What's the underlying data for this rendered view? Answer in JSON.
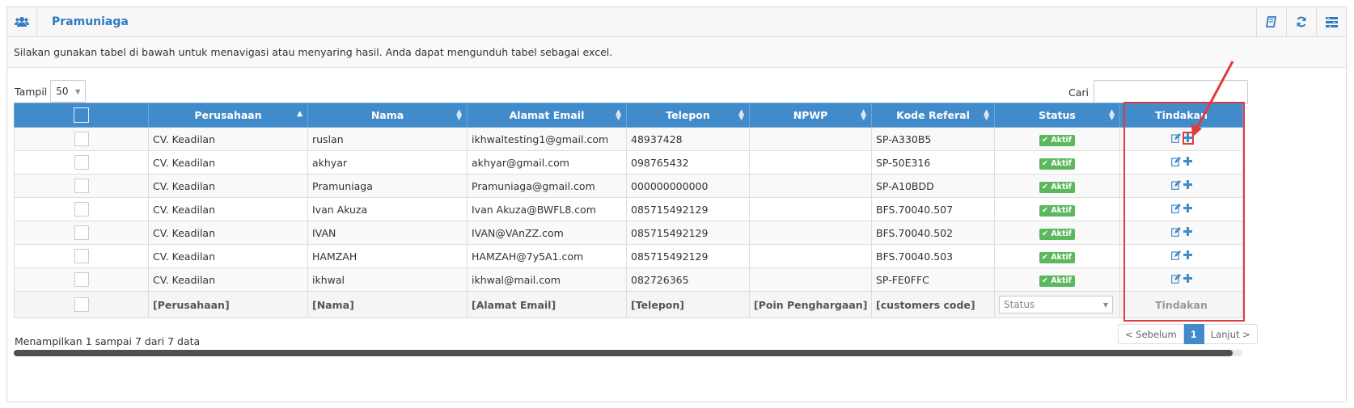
{
  "header": {
    "title": "Pramuniaga",
    "icons": [
      "users-icon",
      "book-icon",
      "refresh-icon",
      "list-settings-icon"
    ]
  },
  "description": "Silakan gunakan tabel di bawah untuk menavigasi atau menyaring hasil. Anda dapat mengunduh tabel sebagai excel.",
  "length_control": {
    "label": "Tampil",
    "value": "50"
  },
  "search": {
    "label": "Cari",
    "value": ""
  },
  "table": {
    "columns": [
      "",
      "Perusahaan",
      "Nama",
      "Alamat Email",
      "Telepon",
      "NPWP",
      "Kode Referal",
      "Status",
      "Tindakan"
    ],
    "rows": [
      {
        "perusahaan": "CV. Keadilan",
        "nama": "ruslan",
        "email": "ikhwaltesting1@gmail.com",
        "telepon": "48937428",
        "npwp": "",
        "kode": "SP-A330B5",
        "status": "Aktif"
      },
      {
        "perusahaan": "CV. Keadilan",
        "nama": "akhyar",
        "email": "akhyar@gmail.com",
        "telepon": "098765432",
        "npwp": "",
        "kode": "SP-50E316",
        "status": "Aktif"
      },
      {
        "perusahaan": "CV. Keadilan",
        "nama": "Pramuniaga",
        "email": "Pramuniaga@gmail.com",
        "telepon": "000000000000",
        "npwp": "",
        "kode": "SP-A10BDD",
        "status": "Aktif"
      },
      {
        "perusahaan": "CV. Keadilan",
        "nama": "Ivan Akuza",
        "email": "Ivan Akuza@BWFL8.com",
        "telepon": "085715492129",
        "npwp": "",
        "kode": "BFS.70040.507",
        "status": "Aktif"
      },
      {
        "perusahaan": "CV. Keadilan",
        "nama": "IVAN",
        "email": "IVAN@VAnZZ.com",
        "telepon": "085715492129",
        "npwp": "",
        "kode": "BFS.70040.502",
        "status": "Aktif"
      },
      {
        "perusahaan": "CV. Keadilan",
        "nama": "HAMZAH",
        "email": "HAMZAH@7y5A1.com",
        "telepon": "085715492129",
        "npwp": "",
        "kode": "BFS.70040.503",
        "status": "Aktif"
      },
      {
        "perusahaan": "CV. Keadilan",
        "nama": "ikhwal",
        "email": "ikhwal@mail.com",
        "telepon": "082726365",
        "npwp": "",
        "kode": "SP-FE0FFC",
        "status": "Aktif"
      }
    ],
    "footer": [
      "",
      "[Perusahaan]",
      "[Nama]",
      "[Alamat Email]",
      "[Telepon]",
      "[Poin Penghargaan]",
      "[customers code]",
      "Status",
      "Tindakan"
    ]
  },
  "info": "Menampilkan 1 sampai 7 dari 7 data",
  "pagination": {
    "prev": "< Sebelum",
    "current": "1",
    "next": "Lanjut >"
  },
  "colors": {
    "header_blue": "#428bca",
    "title_blue": "#2f7bc1",
    "badge_green": "#5cb85c",
    "highlight_red": "#e03b3b"
  }
}
